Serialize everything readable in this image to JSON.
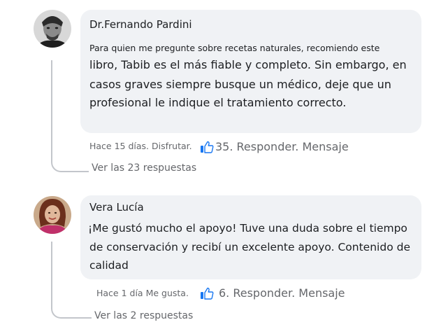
{
  "comments": [
    {
      "author": "Dr.Fernando Pardini",
      "text_first_line": "Para quien me pregunte sobre recetas naturales, recomiendo este",
      "text_lines": [
        "libro, Tabib es el más fiable y completo. Sin embargo, en",
        "casos graves siempre busque un médico, deje que un",
        "profesional le indique el tratamiento correcto."
      ],
      "meta_text": "Hace 15 días. Disfrutar.",
      "likes_and_actions": "35. Responder. Mensaje",
      "replies_link": "Ver las 23 respuestas",
      "avatar_icon": "man-portrait-avatar"
    },
    {
      "author": "Vera Lucía",
      "text_lines": [
        "¡Me gustó mucho el apoyo! Tuve una duda sobre el tiempo",
        "de conservación y recibí un excelente apoyo. Contenido de",
        "calidad"
      ],
      "meta_text": "Hace 1 día Me gusta.",
      "likes_and_actions": "6. Responder. Mensaje",
      "replies_link": "Ver las 2 respuestas",
      "avatar_icon": "woman-portrait-avatar"
    }
  ],
  "colors": {
    "bubble_bg": "#f0f2f5",
    "meta_text": "#65676b",
    "like_icon": "#1877f2",
    "thread_line": "#c3c6cb"
  }
}
